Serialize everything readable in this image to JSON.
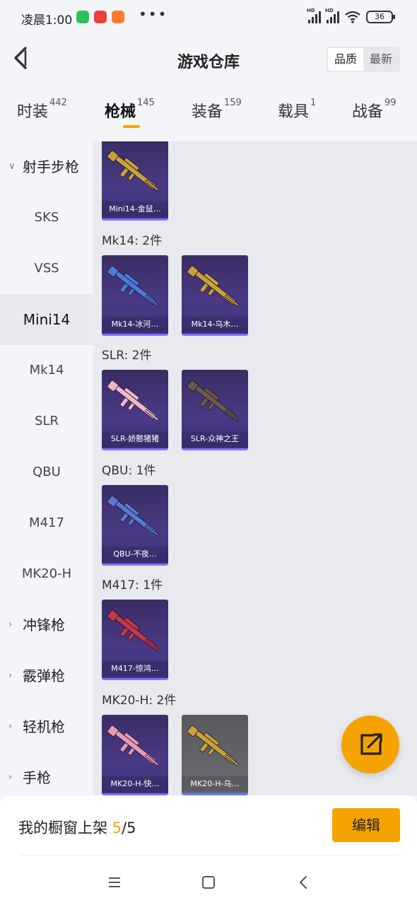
{
  "status_bar": {
    "time": "凌晨1:00",
    "more": "•••",
    "network1": "HD",
    "network2": "HD",
    "battery": "36"
  },
  "header": {
    "title": "游戏仓库",
    "sort_options": [
      "品质",
      "最新"
    ],
    "active_sort": "品质"
  },
  "tabs": [
    {
      "label": "时装",
      "count": "442"
    },
    {
      "label": "枪械",
      "count": "145"
    },
    {
      "label": "装备",
      "count": "159"
    },
    {
      "label": "载具",
      "count": "1"
    },
    {
      "label": "战备",
      "count": "99"
    }
  ],
  "active_tab": "枪械",
  "sidebar": {
    "group_open": "射手步枪",
    "items": [
      "SKS",
      "VSS",
      "Mini14",
      "Mk14",
      "SLR",
      "QBU",
      "M417",
      "MK20-H"
    ],
    "active_item": "Mini14",
    "groups_closed": [
      "冲锋枪",
      "霰弹枪",
      "轻机枪",
      "手枪"
    ]
  },
  "content": {
    "top_card": {
      "name": "Mini14-金鼠…",
      "color": "#c9a13a"
    },
    "sections": [
      {
        "title": "Mk14: 2件",
        "cards": [
          {
            "name": "Mk14-冰河…",
            "color": "#4b7bd6"
          },
          {
            "name": "Mk14-乌木…",
            "color": "#c9a13a"
          }
        ]
      },
      {
        "title": "SLR: 2件",
        "cards": [
          {
            "name": "SLR-娇憨猪猪",
            "color": "#f0b8c8"
          },
          {
            "name": "SLR-众神之王",
            "color": "#6b5a4a"
          }
        ]
      },
      {
        "title": "QBU: 1件",
        "cards": [
          {
            "name": "QBU-不夜…",
            "color": "#5a7ad0"
          }
        ]
      },
      {
        "title": "M417: 1件",
        "cards": [
          {
            "name": "M417-惊鸿…",
            "color": "#c8384a"
          }
        ]
      },
      {
        "title": "MK20-H: 2件",
        "cards": [
          {
            "name": "MK20-H-快…",
            "color": "#e89ab8"
          },
          {
            "name": "MK20-H-乌…",
            "color": "#c9a13a"
          }
        ]
      }
    ]
  },
  "bottom_bar": {
    "label": "我的橱窗上架",
    "shown": "5",
    "total": "/5",
    "edit_label": "编辑"
  },
  "colors": {
    "accent": "#f5a300",
    "card_bg": "#3f3279"
  }
}
